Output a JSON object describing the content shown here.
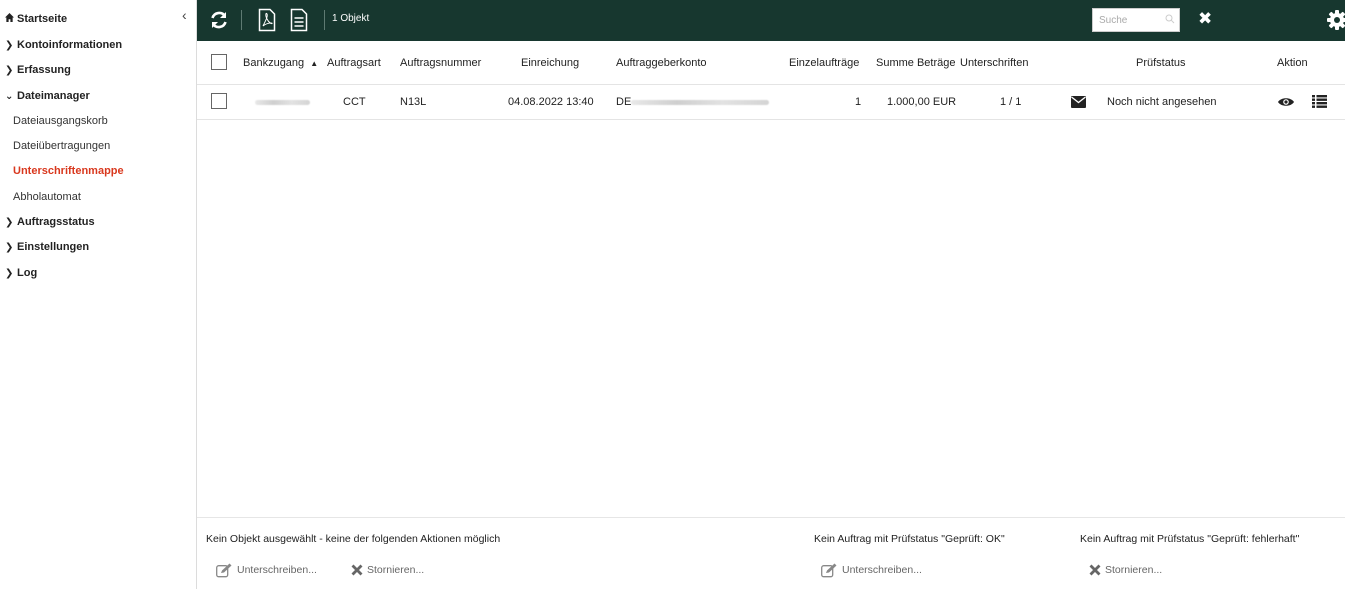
{
  "sidebar": {
    "collapse_icon": "chevron-left-icon",
    "home": {
      "label": "Startseite",
      "icon": "home-icon"
    },
    "items": [
      {
        "label": "Kontoinformationen",
        "icon": "chevron-right-icon"
      },
      {
        "label": "Erfassung",
        "icon": "chevron-right-icon"
      },
      {
        "label": "Dateimanager",
        "icon": "chevron-down-icon"
      },
      {
        "label": "Auftragsstatus",
        "icon": "chevron-right-icon"
      },
      {
        "label": "Einstellungen",
        "icon": "chevron-right-icon"
      },
      {
        "label": "Log",
        "icon": "chevron-right-icon"
      }
    ],
    "subitems": [
      {
        "label": "Dateiausgangskorb"
      },
      {
        "label": "Dateiübertragungen"
      },
      {
        "label": "Unterschriftenmappe",
        "active": true
      },
      {
        "label": "Abholautomat"
      }
    ]
  },
  "toolbar": {
    "object_count": "1 Objekt",
    "search_placeholder": "Suche",
    "icons": [
      "refresh-icon",
      "pdf-icon",
      "document-icon",
      "search-icon",
      "close-icon",
      "gear-icon"
    ]
  },
  "table": {
    "columns": {
      "bankzugang": "Bankzugang",
      "auftragsart": "Auftragsart",
      "auftragsnummer": "Auftragsnummer",
      "einreichung": "Einreichung",
      "auftraggeberkonto": "Auftraggeberkonto",
      "einzelauftraege": "Einzelaufträge",
      "summe": "Summe Beträge",
      "unterschriften": "Unterschriften",
      "pruefstatus": "Prüfstatus",
      "aktion": "Aktion"
    },
    "sort_icon": "sort-up-icon",
    "rows": [
      {
        "auftragsart": "CCT",
        "auftragsnummer": "N13L",
        "einreichung": "04.08.2022 13:40",
        "auftraggeberkonto_prefix": "DE",
        "einzelauftraege": "1",
        "summe": "1.000,00 EUR",
        "unterschriften": "1 / 1",
        "pruefstatus": "Noch nicht angesehen",
        "icons": [
          "envelope-icon",
          "eye-icon",
          "list-icon"
        ]
      }
    ]
  },
  "bottom": {
    "group1": {
      "label": "Kein Objekt ausgewählt - keine der folgenden Aktionen möglich",
      "sign": "Unterschreiben...",
      "cancel": "Stornieren..."
    },
    "group2": {
      "label": "Kein Auftrag mit Prüfstatus \"Geprüft: OK\"",
      "sign": "Unterschreiben..."
    },
    "group3": {
      "label": "Kein Auftrag mit Prüfstatus \"Geprüft: fehlerhaft\"",
      "cancel": "Stornieren..."
    }
  },
  "colors": {
    "toolbar_bg": "#17372f",
    "active_nav": "#d9381e"
  }
}
